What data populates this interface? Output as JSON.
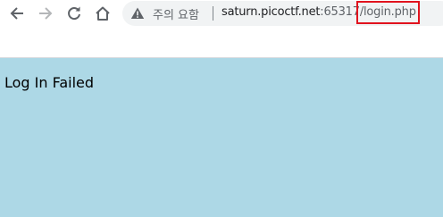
{
  "toolbar": {
    "back_icon": "arrow-left-icon",
    "forward_icon": "arrow-right-icon",
    "reload_icon": "reload-icon",
    "home_icon": "home-icon"
  },
  "address_bar": {
    "security_icon": "warning-triangle-icon",
    "security_label": "주의 요함",
    "url_host": "saturn.picoctf.net",
    "url_rest": ":65317/login.php"
  },
  "page": {
    "message": "Log In Failed",
    "background_color": "#add8e6"
  },
  "colors": {
    "highlight_box": "#e1131e",
    "address_bar_bg": "#f1f3f4"
  }
}
